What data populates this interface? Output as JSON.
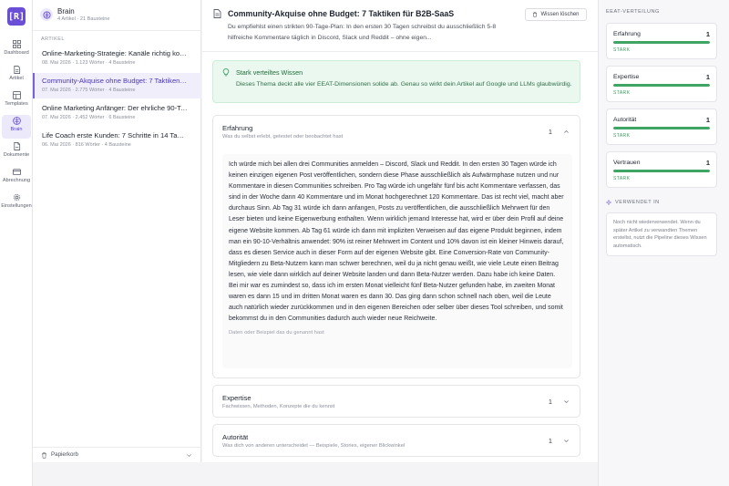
{
  "nav": {
    "logo": "[R]",
    "items": [
      {
        "label": "Dashboard",
        "icon": "grid-icon"
      },
      {
        "label": "Artikel",
        "icon": "file-icon"
      },
      {
        "label": "Templates",
        "icon": "template-icon"
      },
      {
        "label": "Brain",
        "icon": "brain-icon",
        "active": true
      },
      {
        "label": "Dokumente",
        "icon": "document-icon"
      },
      {
        "label": "Abrechnung",
        "icon": "card-icon"
      },
      {
        "label": "Einstellungen",
        "icon": "gear-icon"
      }
    ]
  },
  "brain": {
    "title": "Brain",
    "subtitle": "4 Artikel · 21 Bausteine"
  },
  "list": {
    "section_label": "ARTIKEL",
    "articles": [
      {
        "title": "Online-Marketing-Strategie: Kanäle richtig kombinieren",
        "meta": "08. Mai 2026 · 1.123 Wörter · 4 Bausteine"
      },
      {
        "title": "Community-Akquise ohne Budget: 7 Taktiken für B2B-SaaS",
        "meta": "07. Mai 2026 · 2.775 Wörter · 4 Bausteine",
        "active": true
      },
      {
        "title": "Online Marketing Anfänger: Der ehrliche 90-Tage-Plan",
        "meta": "07. Mai 2026 · 2.452 Wörter · 6 Bausteine"
      },
      {
        "title": "Life Coach erste Kunden: 7 Schritte in 14 Tagen",
        "meta": "06. Mai 2026 · 816 Wörter · 4 Bausteine"
      }
    ],
    "trash_label": "Papierkorb"
  },
  "main": {
    "title": "Community-Akquise ohne Budget: 7 Taktiken für B2B-SaaS",
    "description": "Du empfiehlst einen strikten 90-Tage-Plan: In den ersten 30 Tagen schreibst du ausschließlich 5-8 hilfreiche Kommentare täglich in Discord, Slack und Reddit – ohne eigen...",
    "clear_label": "Wissen löschen",
    "notice": {
      "title": "Stark verteiltes Wissen",
      "text": "Dieses Thema deckt alle vier EEAT-Dimensionen solide ab. Genau so wirkt dein Artikel auf Google und LLMs glaubwürdig."
    },
    "cards": [
      {
        "title": "Erfahrung",
        "subtitle": "Was du selbst erlebt, getestet oder beobachtet hast",
        "count": "1",
        "expanded": true,
        "body": "Ich würde mich bei allen drei Communities anmelden – Discord, Slack und Reddit. In den ersten 30 Tagen würde ich keinen einzigen eigenen Post veröffentlichen, sondern diese Phase ausschließlich als Aufwärmphase nutzen und nur Kommentare in diesen Communities schreiben. Pro Tag würde ich ungefähr fünf bis acht Kommentare verfassen, das sind in der Woche dann 40 Kommentare und im Monat hochgerechnet 120 Kommentare. Das ist recht viel, macht aber durchaus Sinn. Ab Tag 31 würde ich dann anfangen, Posts zu veröffentlichen, die ausschließlich Mehrwert für den Leser bieten und keine Eigenwerbung enthalten. Wenn wirklich jemand Interesse hat, wird er über dein Profil auf deine eigene Website kommen. Ab Tag 61 würde ich dann mit impliziten Verweisen auf das eigene Produkt beginnen, indem man ein 90-10-Verhältnis anwendet: 90% ist reiner Mehrwert im Content und 10% davon ist ein kleiner Hinweis darauf, dass es diesen Service auch in dieser Form auf der eigenen Website gibt. Eine Conversion-Rate von Community-Mitgliedern zu Beta-Nutzern kann man schwer berechnen, weil du ja nicht genau weißt, wie viele Leute einen Beitrag lesen, wie viele dann wirklich auf deiner Website landen und dann Beta-Nutzer werden. Dazu habe ich keine Daten. Bei mir war es zumindest so, dass ich im ersten Monat vielleicht fünf Beta-Nutzer gefunden habe, im zweiten Monat waren es dann 15 und im dritten Monat waren es dann 30. Das ging dann schon schnell nach oben, weil die Leute auch natürlich wieder zurückkommen und in den eigenen Bereichen oder selber über dieses Tool schreiben, und somit bekommst du in den Communities dadurch auch wieder neue Reichweite.",
        "hint": "Daten oder Beispiel das du genannt hast"
      },
      {
        "title": "Expertise",
        "subtitle": "Fachwissen, Methoden, Konzepte die du kennst",
        "count": "1",
        "expanded": false
      },
      {
        "title": "Autorität",
        "subtitle": "Was dich von anderen unterscheidet — Beispiele, Stories, eigener Blickwinkel",
        "count": "1",
        "expanded": false
      }
    ]
  },
  "eeat": {
    "label": "EEAT-VERTEILUNG",
    "metrics": [
      {
        "name": "Erfahrung",
        "value": "1",
        "status": "STARK",
        "fill": 1.0
      },
      {
        "name": "Expertise",
        "value": "1",
        "status": "STARK",
        "fill": 1.0
      },
      {
        "name": "Autorität",
        "value": "1",
        "status": "STARK",
        "fill": 1.0
      },
      {
        "name": "Vertrauen",
        "value": "1",
        "status": "STARK",
        "fill": 1.0
      }
    ],
    "used_label": "VERWENDET IN",
    "used_text": "Noch nicht wiederverwendet. Wenn du später Artikel zu verwandten Themen erstellst, nutzt die Pipeline dieses Wissen automatisch."
  },
  "colors": {
    "accent": "#6a4ed6",
    "success": "#3fa464",
    "notice_bg": "#ebf8ef"
  }
}
